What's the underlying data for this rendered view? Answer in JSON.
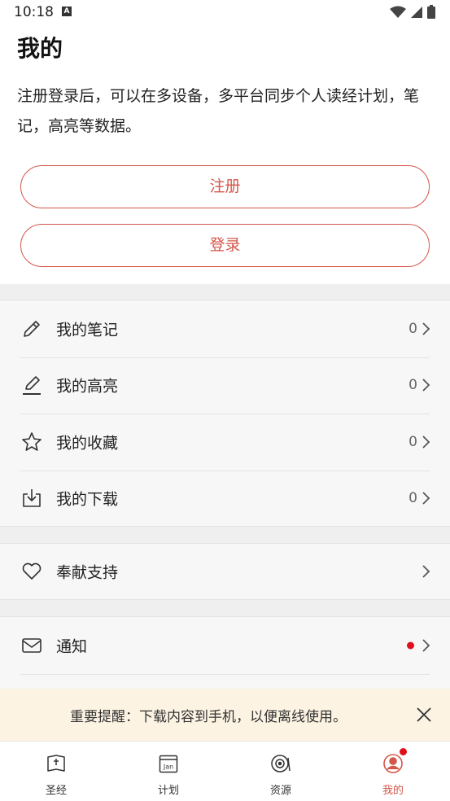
{
  "status": {
    "time": "10:18",
    "notif_letter": "A"
  },
  "page": {
    "title": "我的",
    "intro": "注册登录后，可以在多设备，多平台同步个人读经计划，笔记，高亮等数据。"
  },
  "auth": {
    "register_label": "注册",
    "login_label": "登录"
  },
  "library": {
    "items": [
      {
        "label": "我的笔记",
        "count": "0",
        "icon": "pencil-icon"
      },
      {
        "label": "我的高亮",
        "count": "0",
        "icon": "highlighter-icon"
      },
      {
        "label": "我的收藏",
        "count": "0",
        "icon": "star-icon"
      },
      {
        "label": "我的下载",
        "count": "0",
        "icon": "download-icon"
      }
    ]
  },
  "support": {
    "label": "奉献支持",
    "icon": "heart-icon"
  },
  "notify": {
    "label": "通知",
    "icon": "mail-icon",
    "has_unread": true
  },
  "banner": {
    "text": "重要提醒：下载内容到手机，以便离线使用。"
  },
  "tabs": [
    {
      "label": "圣经",
      "icon": "bible-icon"
    },
    {
      "label": "计划",
      "icon": "calendar-icon",
      "icon_text": "Jan"
    },
    {
      "label": "资源",
      "icon": "disc-icon"
    },
    {
      "label": "我的",
      "icon": "profile-icon",
      "active": true
    }
  ],
  "colors": {
    "accent": "#d4564a",
    "badge": "#e0101b",
    "banner_bg": "#fcf3e3"
  }
}
